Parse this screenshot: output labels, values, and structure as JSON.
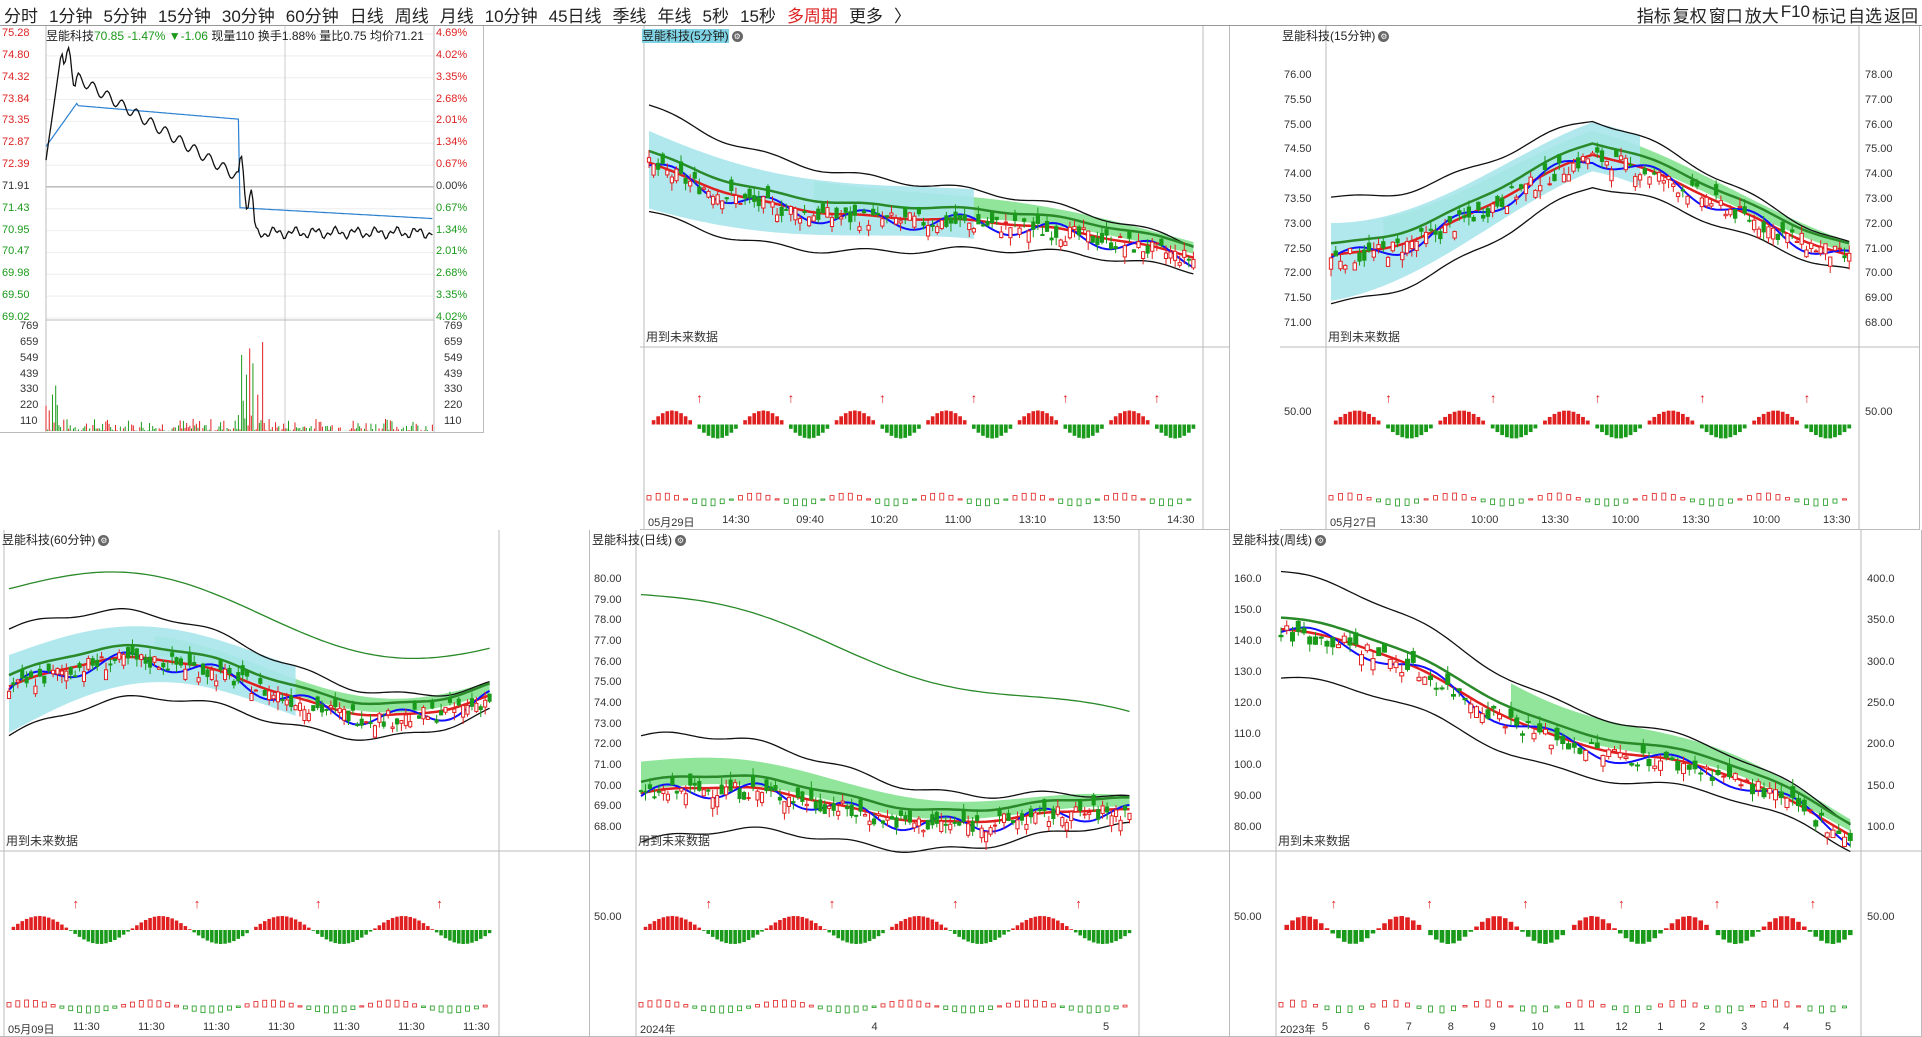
{
  "toolbar": {
    "periods": [
      "分时",
      "1分钟",
      "5分钟",
      "15分钟",
      "30分钟",
      "60分钟",
      "日线",
      "周线",
      "月线",
      "10分钟",
      "45日线",
      "季线",
      "年线",
      "5秒",
      "15秒",
      "多周期",
      "更多"
    ],
    "more_arrow": "〉",
    "right_buttons": [
      "指标",
      "复权",
      "窗口",
      "放大",
      "F10",
      "标记",
      "自选",
      "返回"
    ]
  },
  "minute_panel": {
    "stock": "昱能科技",
    "last": "70.85",
    "change_pct": "-1.47%",
    "change": "▼-1.06",
    "volume_label": "现量",
    "volume": "110",
    "turnover_label": "换手",
    "turnover": "1.88%",
    "ratio_label": "量比",
    "ratio": "0.75",
    "avg_label": "均价",
    "avg": "71.21",
    "price_ticks": [
      "75.28",
      "74.80",
      "74.32",
      "73.84",
      "73.35",
      "72.87",
      "72.39",
      "71.91",
      "71.43",
      "70.95",
      "70.47",
      "69.98",
      "69.50",
      "69.02"
    ],
    "pct_ticks": [
      "4.69%",
      "4.02%",
      "3.35%",
      "2.68%",
      "2.01%",
      "1.34%",
      "0.67%",
      "0.00%",
      "0.67%",
      "1.34%",
      "2.01%",
      "2.68%",
      "3.35%",
      "4.02%"
    ],
    "vol_ticks": [
      "769",
      "659",
      "549",
      "439",
      "330",
      "220",
      "110"
    ],
    "colors": {
      "up": "#e02020",
      "down": "#1a9a1a",
      "price": "#111111",
      "avg": "#2a80d0"
    }
  },
  "panels": [
    {
      "id": "p5",
      "title": "昱能科技(5分钟)",
      "future": "用到未来数据",
      "y_ticks": [],
      "y_right": [],
      "x_labels": [
        "05月29日",
        "14:30",
        "09:40",
        "10:20",
        "11:00",
        "13:10",
        "13:50",
        "14:30"
      ],
      "osc_tick": ""
    },
    {
      "id": "p15",
      "title": "昱能科技(15分钟)",
      "future": "用到未来数据",
      "y_ticks": [
        "76.00",
        "75.50",
        "75.00",
        "74.50",
        "74.00",
        "73.50",
        "73.00",
        "72.50",
        "72.00",
        "71.50",
        "71.00"
      ],
      "y_right": [
        "78.00",
        "77.00",
        "76.00",
        "75.00",
        "74.00",
        "73.00",
        "72.00",
        "71.00",
        "70.00",
        "69.00",
        "68.00"
      ],
      "x_labels": [
        "05月27日",
        "13:30",
        "10:00",
        "13:30",
        "10:00",
        "13:30",
        "10:00",
        "13:30"
      ],
      "osc_tick": "50.00"
    },
    {
      "id": "p60",
      "title": "昱能科技(60分钟)",
      "future": "用到未来数据",
      "y_ticks": [],
      "y_right": [],
      "x_labels": [
        "05月09日",
        "11:30",
        "11:30",
        "11:30",
        "11:30",
        "11:30",
        "11:30",
        "11:30"
      ],
      "osc_tick": ""
    },
    {
      "id": "pday",
      "title": "昱能科技(日线)",
      "future": "用到未来数据",
      "y_ticks": [
        "80.00",
        "79.00",
        "78.00",
        "77.00",
        "76.00",
        "75.00",
        "74.00",
        "73.00",
        "72.00",
        "71.00",
        "70.00",
        "69.00",
        "68.00"
      ],
      "y_right": [],
      "x_labels": [
        "2024年",
        "4",
        "5"
      ],
      "osc_tick": "50.00"
    },
    {
      "id": "pweek",
      "title": "昱能科技(周线)",
      "future": "用到未来数据",
      "y_ticks": [
        "160.0",
        "150.0",
        "140.0",
        "130.0",
        "120.0",
        "110.0",
        "100.0",
        "90.00",
        "80.00"
      ],
      "y_right": [
        "400.0",
        "350.0",
        "300.0",
        "250.0",
        "200.0",
        "150.0",
        "100.0"
      ],
      "x_labels": [
        "2023年",
        "5",
        "6",
        "7",
        "8",
        "9",
        "10",
        "11",
        "12",
        "1",
        "2",
        "3",
        "4",
        "5"
      ],
      "osc_tick": "50.00"
    }
  ]
}
